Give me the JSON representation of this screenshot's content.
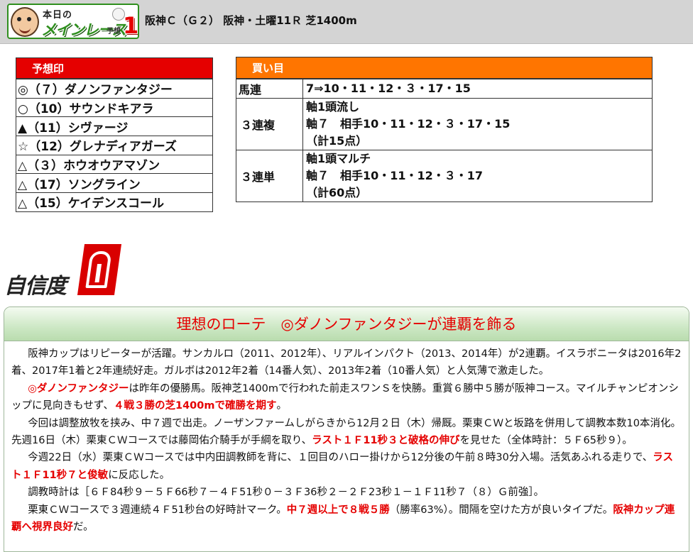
{
  "header": {
    "logo_small": "本日の",
    "logo_main": "メインレース",
    "logo_sub": "予想",
    "logo_num": "1",
    "race_title": "阪神Ｃ（Ｇ２） 阪神・土曜11Ｒ 芝1400m"
  },
  "marks": {
    "title": "予想印",
    "items": [
      "◎（７）ダノンファンタジー",
      "○（10）サウンドキアラ",
      "▲（11）シヴァージ",
      "☆（12）グレナディアガーズ",
      "△（３）ホウオウアマゾン",
      "△（17）ソングライン",
      "△（15）ケイデンスコール"
    ]
  },
  "bets": {
    "title": "買い目",
    "rows": [
      {
        "type": "馬連",
        "lines": [
          "7⇒10・11・12・３・17・15"
        ]
      },
      {
        "type": "３連複",
        "lines": [
          "軸1頭流し",
          "軸７　相手10・11・12・３・17・15",
          "（計15点）"
        ]
      },
      {
        "type": "３連単",
        "lines": [
          "軸1頭マルチ",
          "軸７　相手10・11・12・３・17",
          "（計60点）"
        ]
      }
    ]
  },
  "confidence": {
    "label": "自信度",
    "level": "A"
  },
  "article": {
    "headline": "理想のローテ　◎ダノンファンタジーが連覇を飾る",
    "paragraphs": [
      [
        {
          "text": "阪神カップはリピーターが活躍。サンカルロ（2011、2012年）、リアルインパクト（2013、2014年）が2連覇。イスラボニータは2016年2着、2017年1着と2年連続好走。ガルボは2012年2着（14番人気）、2013年2着（10番人気）と人気薄で激走した。",
          "red": false
        }
      ],
      [
        {
          "text": "◎ダノンファンタジー",
          "red": true
        },
        {
          "text": "は昨年の優勝馬。阪神芝1400mで行われた前走スワンＳを快勝。重賞６勝中５勝が阪神コース。マイルチャンピオンシップに見向きもせず、",
          "red": false
        },
        {
          "text": "４戦３勝の芝1400mで確勝を期す",
          "red": true
        },
        {
          "text": "。",
          "red": false
        }
      ],
      [
        {
          "text": "今回は調整放牧を挟み、中７週で出走。ノーザンファームしがらきから12月２日（木）帰厩。栗東ＣＷと坂路を併用して調教本数10本消化。先週16日（木）栗東ＣＷコースでは藤岡佑介騎手が手綱を取り、",
          "red": false
        },
        {
          "text": "ラスト１Ｆ11秒３と破格の伸び",
          "red": true
        },
        {
          "text": "を見せた（全体時計：５Ｆ65秒９）。",
          "red": false
        }
      ],
      [
        {
          "text": "今週22日（水）栗東ＣＷコースでは中内田調教師を背に、１回目のハロー掛けから12分後の午前８時30分入場。活気あふれる走りで、",
          "red": false
        },
        {
          "text": "ラスト１Ｆ11秒７と俊敏",
          "red": true
        },
        {
          "text": "に反応した。",
          "red": false
        }
      ],
      [
        {
          "text": "調教時計は［６Ｆ84秒９－５Ｆ66秒７－４Ｆ51秒０－３Ｆ36秒２－２Ｆ23秒１－１Ｆ11秒７（８）Ｇ前強］。",
          "red": false
        }
      ],
      [
        {
          "text": "栗東ＣＷコースで３週連続４Ｆ51秒台の好時計マーク。",
          "red": false
        },
        {
          "text": "中７週以上で８戦５勝",
          "red": true
        },
        {
          "text": "（勝率63%）。間隔を空けた方が良いタイプだ。",
          "red": false
        },
        {
          "text": "阪神カップ連覇へ視界良好",
          "red": true
        },
        {
          "text": "だ。",
          "red": false
        }
      ]
    ]
  },
  "colors": {
    "marks_header": "#e50000",
    "bets_header": "#ff7500",
    "headline_text": "#e50000",
    "emphasis_text": "#e50000",
    "header_bg": "#d4d4d4"
  }
}
